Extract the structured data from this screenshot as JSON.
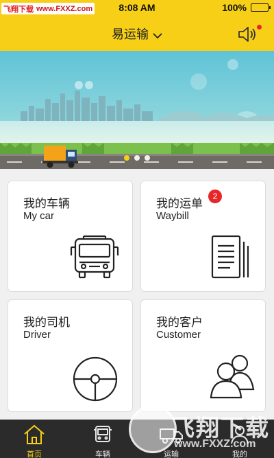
{
  "status_bar": {
    "watermark_cn": "飞翔下载",
    "watermark_url": "www.FXXZ.com",
    "time": "8:08 AM",
    "battery_percent": "100%",
    "battery_level": 1.0
  },
  "nav": {
    "title": "易运输",
    "chevron_icon": "chevron-down-icon",
    "speaker_icon": "speaker-icon",
    "has_notification_dot": true
  },
  "banner": {
    "page_count": 3,
    "active_page": 1
  },
  "cards": [
    {
      "title_cn": "我的车辆",
      "title_en": "My car",
      "icon": "bus-icon"
    },
    {
      "title_cn": "我的运单",
      "title_en": "Waybill",
      "icon": "waybill-icon",
      "badge": "2"
    },
    {
      "title_cn": "我的司机",
      "title_en": "Driver",
      "icon": "steering-wheel-icon"
    },
    {
      "title_cn": "我的客户",
      "title_en": "Customer",
      "icon": "customers-icon"
    }
  ],
  "tabs": [
    {
      "label": "首页",
      "icon": "home-icon",
      "active": true
    },
    {
      "label": "车辆",
      "icon": "vehicle-icon",
      "active": false
    },
    {
      "label": "运输",
      "icon": "transport-icon",
      "active": false
    },
    {
      "label": "我的",
      "icon": "profile-icon",
      "active": false
    }
  ],
  "watermark_overlay": {
    "text": "飞翔下载",
    "url": "www.FXXZ.com"
  },
  "colors": {
    "brand_yellow": "#f7cf16",
    "badge_red": "#e8262a",
    "tab_bar_bg": "#2b2b2b",
    "card_bg": "#ffffff",
    "page_bg": "#f0f0f0"
  }
}
